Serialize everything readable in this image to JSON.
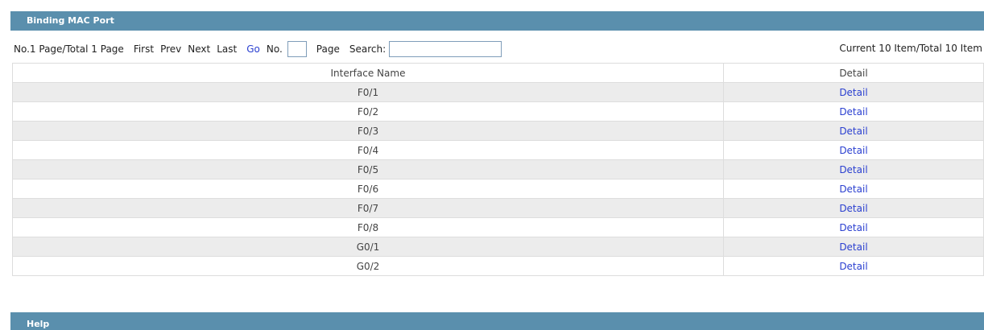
{
  "header": {
    "title": "Binding MAC Port"
  },
  "pager": {
    "page_info": "No.1 Page/Total 1 Page",
    "first": "First",
    "prev": "Prev",
    "next": "Next",
    "last": "Last",
    "go": "Go",
    "no_label": "No.",
    "page_label": "Page",
    "search_label": "Search:",
    "item_info": "Current 10 Item/Total 10 Item"
  },
  "table": {
    "columns": [
      "Interface Name",
      "Detail"
    ],
    "rows": [
      {
        "name": "F0/1",
        "detail": "Detail"
      },
      {
        "name": "F0/2",
        "detail": "Detail"
      },
      {
        "name": "F0/3",
        "detail": "Detail"
      },
      {
        "name": "F0/4",
        "detail": "Detail"
      },
      {
        "name": "F0/5",
        "detail": "Detail"
      },
      {
        "name": "F0/6",
        "detail": "Detail"
      },
      {
        "name": "F0/7",
        "detail": "Detail"
      },
      {
        "name": "F0/8",
        "detail": "Detail"
      },
      {
        "name": "G0/1",
        "detail": "Detail"
      },
      {
        "name": "G0/2",
        "detail": "Detail"
      }
    ]
  },
  "help": {
    "title": "Help"
  },
  "colors": {
    "header_bg": "#5a8fad",
    "link": "#2a3fd0",
    "row_alt": "#ececec"
  }
}
